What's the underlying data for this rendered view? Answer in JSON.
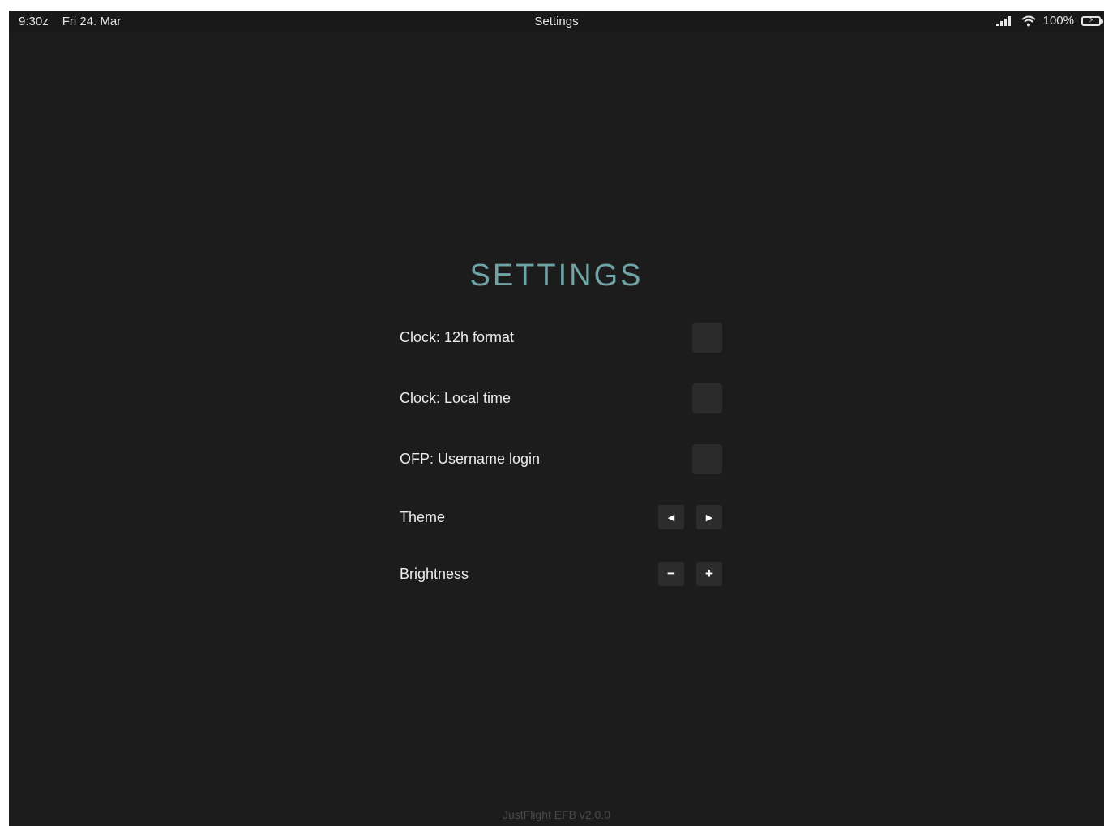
{
  "status_bar": {
    "time": "9:30z",
    "date": "Fri 24. Mar",
    "title": "Settings",
    "battery_percent": "100%",
    "icons": [
      "signal-icon",
      "wifi-icon",
      "battery-charging-icon"
    ]
  },
  "page": {
    "heading": "SETTINGS",
    "accent_color": "#6fa4a6"
  },
  "settings": {
    "clock_12h": {
      "label": "Clock: 12h format"
    },
    "clock_local": {
      "label": "Clock: Local time"
    },
    "ofp_username": {
      "label": "OFP: Username login"
    },
    "theme": {
      "label": "Theme",
      "prev_symbol": "◀",
      "next_symbol": "▶"
    },
    "brightness": {
      "label": "Brightness",
      "decrease_symbol": "−",
      "increase_symbol": "+"
    }
  },
  "footer": {
    "version": "JustFlight EFB v2.0.0"
  }
}
